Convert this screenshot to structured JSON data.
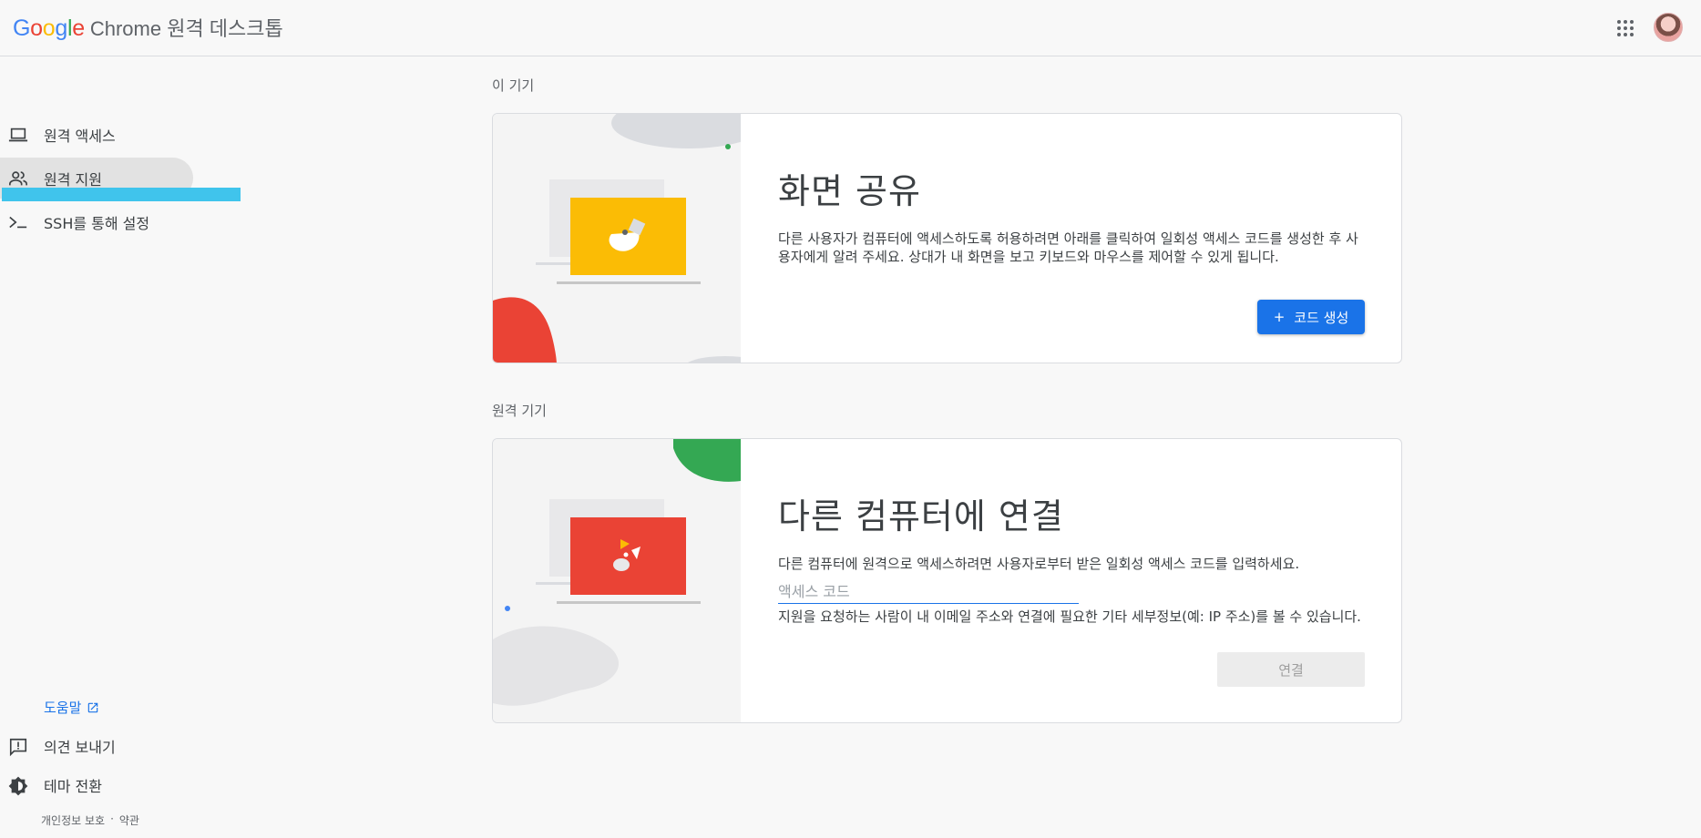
{
  "header": {
    "google_letters": [
      {
        "ch": "G",
        "color": "#4285f4"
      },
      {
        "ch": "o",
        "color": "#ea4335"
      },
      {
        "ch": "o",
        "color": "#fbbc05"
      },
      {
        "ch": "g",
        "color": "#4285f4"
      },
      {
        "ch": "l",
        "color": "#34a853"
      },
      {
        "ch": "e",
        "color": "#ea4335"
      }
    ],
    "product_name": "Chrome 원격 데스크톱",
    "apps_icon": "apps-grid-icon",
    "avatar_icon": "account-avatar"
  },
  "sidebar": {
    "items": [
      {
        "label": "원격 액세스",
        "icon": "laptop-icon",
        "active": false
      },
      {
        "label": "원격 지원",
        "icon": "people-icon",
        "active": true
      },
      {
        "label": "SSH를 통해 설정",
        "icon": "terminal-icon",
        "active": false
      }
    ],
    "help_label": "도움말",
    "feedback_label": "의견 보내기",
    "theme_label": "테마 전환",
    "privacy_label": "개인정보 보호",
    "separator": "·",
    "terms_label": "약관"
  },
  "main": {
    "this_device": {
      "section_title": "이 기기",
      "title": "화면 공유",
      "description": "다른 사용자가 컴퓨터에 액세스하도록 허용하려면 아래를 클릭하여 일회성 액세스 코드를 생성한 후 사용자에게 알려 주세요. 상대가 내 화면을 보고 키보드와 마우스를 제어할 수 있게 됩니다.",
      "button_icon": "+",
      "button_label": "코드 생성"
    },
    "remote_device": {
      "section_title": "원격 기기",
      "title": "다른 컴퓨터에 연결",
      "description": "다른 컴퓨터에 원격으로 액세스하려면 사용자로부터 받은 일회성 액세스 코드를 입력하세요.",
      "input_placeholder": "액세스 코드",
      "input_value": "",
      "hint": "지원을 요청하는 사람이 내 이메일 주소와 연결에 필요한 기타 세부정보(예: IP 주소)를 볼 수 있습니다.",
      "connect_label": "연결"
    }
  },
  "colors": {
    "accent": "#1a73e8",
    "yellow": "#fbbc05",
    "red": "#ea4335",
    "green": "#34a853",
    "active_indicator": "#40c4ec"
  }
}
